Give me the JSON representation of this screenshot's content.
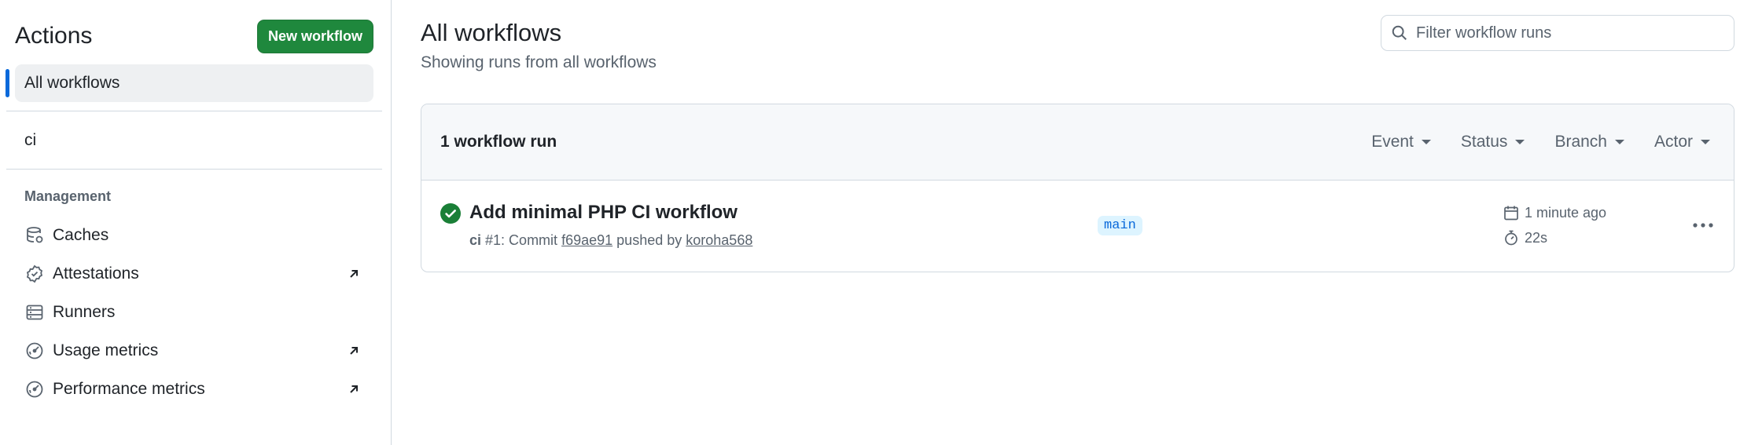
{
  "sidebar": {
    "title": "Actions",
    "new_workflow_label": "New workflow",
    "all_workflows_label": "All workflows",
    "workflows": [
      {
        "label": "ci"
      }
    ],
    "management_label": "Management",
    "management_items": [
      {
        "label": "Caches",
        "icon": "database-icon",
        "external": false
      },
      {
        "label": "Attestations",
        "icon": "verified-icon",
        "external": true
      },
      {
        "label": "Runners",
        "icon": "server-icon",
        "external": false
      },
      {
        "label": "Usage metrics",
        "icon": "meter-icon",
        "external": true
      },
      {
        "label": "Performance metrics",
        "icon": "meter-icon",
        "external": true
      }
    ]
  },
  "main": {
    "title": "All workflows",
    "subtitle": "Showing runs from all workflows",
    "search": {
      "placeholder": "Filter workflow runs",
      "value": ""
    },
    "run_count": "1 workflow run",
    "filters": [
      {
        "label": "Event"
      },
      {
        "label": "Status"
      },
      {
        "label": "Branch"
      },
      {
        "label": "Actor"
      }
    ],
    "runs": [
      {
        "status": "success",
        "title": "Add minimal PHP CI workflow",
        "workflow": "ci",
        "run_number": "#1: Commit",
        "commit": "f69ae91",
        "pushed_by_label": "pushed by",
        "actor": "koroha568",
        "branch": "main",
        "time_ago": "1 minute ago",
        "duration": "22s"
      }
    ]
  },
  "colors": {
    "accent": "#0969da",
    "success": "#1a7f37",
    "button_green": "#1f883d",
    "muted_text": "#59636e",
    "border": "#d1d9e0"
  }
}
